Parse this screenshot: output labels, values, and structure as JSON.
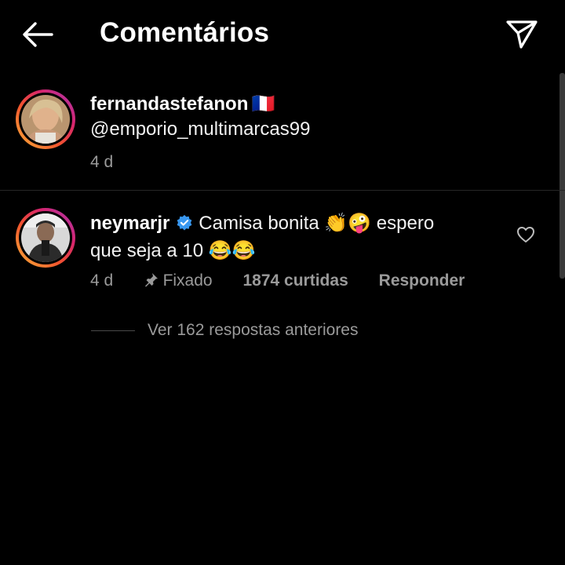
{
  "header": {
    "title": "Comentários",
    "back_icon": "arrow-left-icon",
    "send_icon": "paper-plane-icon"
  },
  "caption": {
    "username": "fernandastefanon",
    "flag": "🇫🇷",
    "text": "@emporio_multimarcas99",
    "time": "4 d"
  },
  "comment": {
    "username": "neymarjr",
    "verified_icon": "verified-badge-icon",
    "text_line1": "Camisa bonita 👏🤪 espero",
    "text_line2": "que seja a 10 😂😂",
    "time": "4 d",
    "pinned_label": "Fixado",
    "likes": "1874 curtidas",
    "reply_label": "Responder",
    "like_icon": "heart-outline-icon"
  },
  "replies": {
    "view_label": "Ver 162 respostas anteriores"
  },
  "colors": {
    "background": "#000000",
    "text": "#ffffff",
    "muted": "#9a9a9a",
    "verified": "#3897f0"
  }
}
